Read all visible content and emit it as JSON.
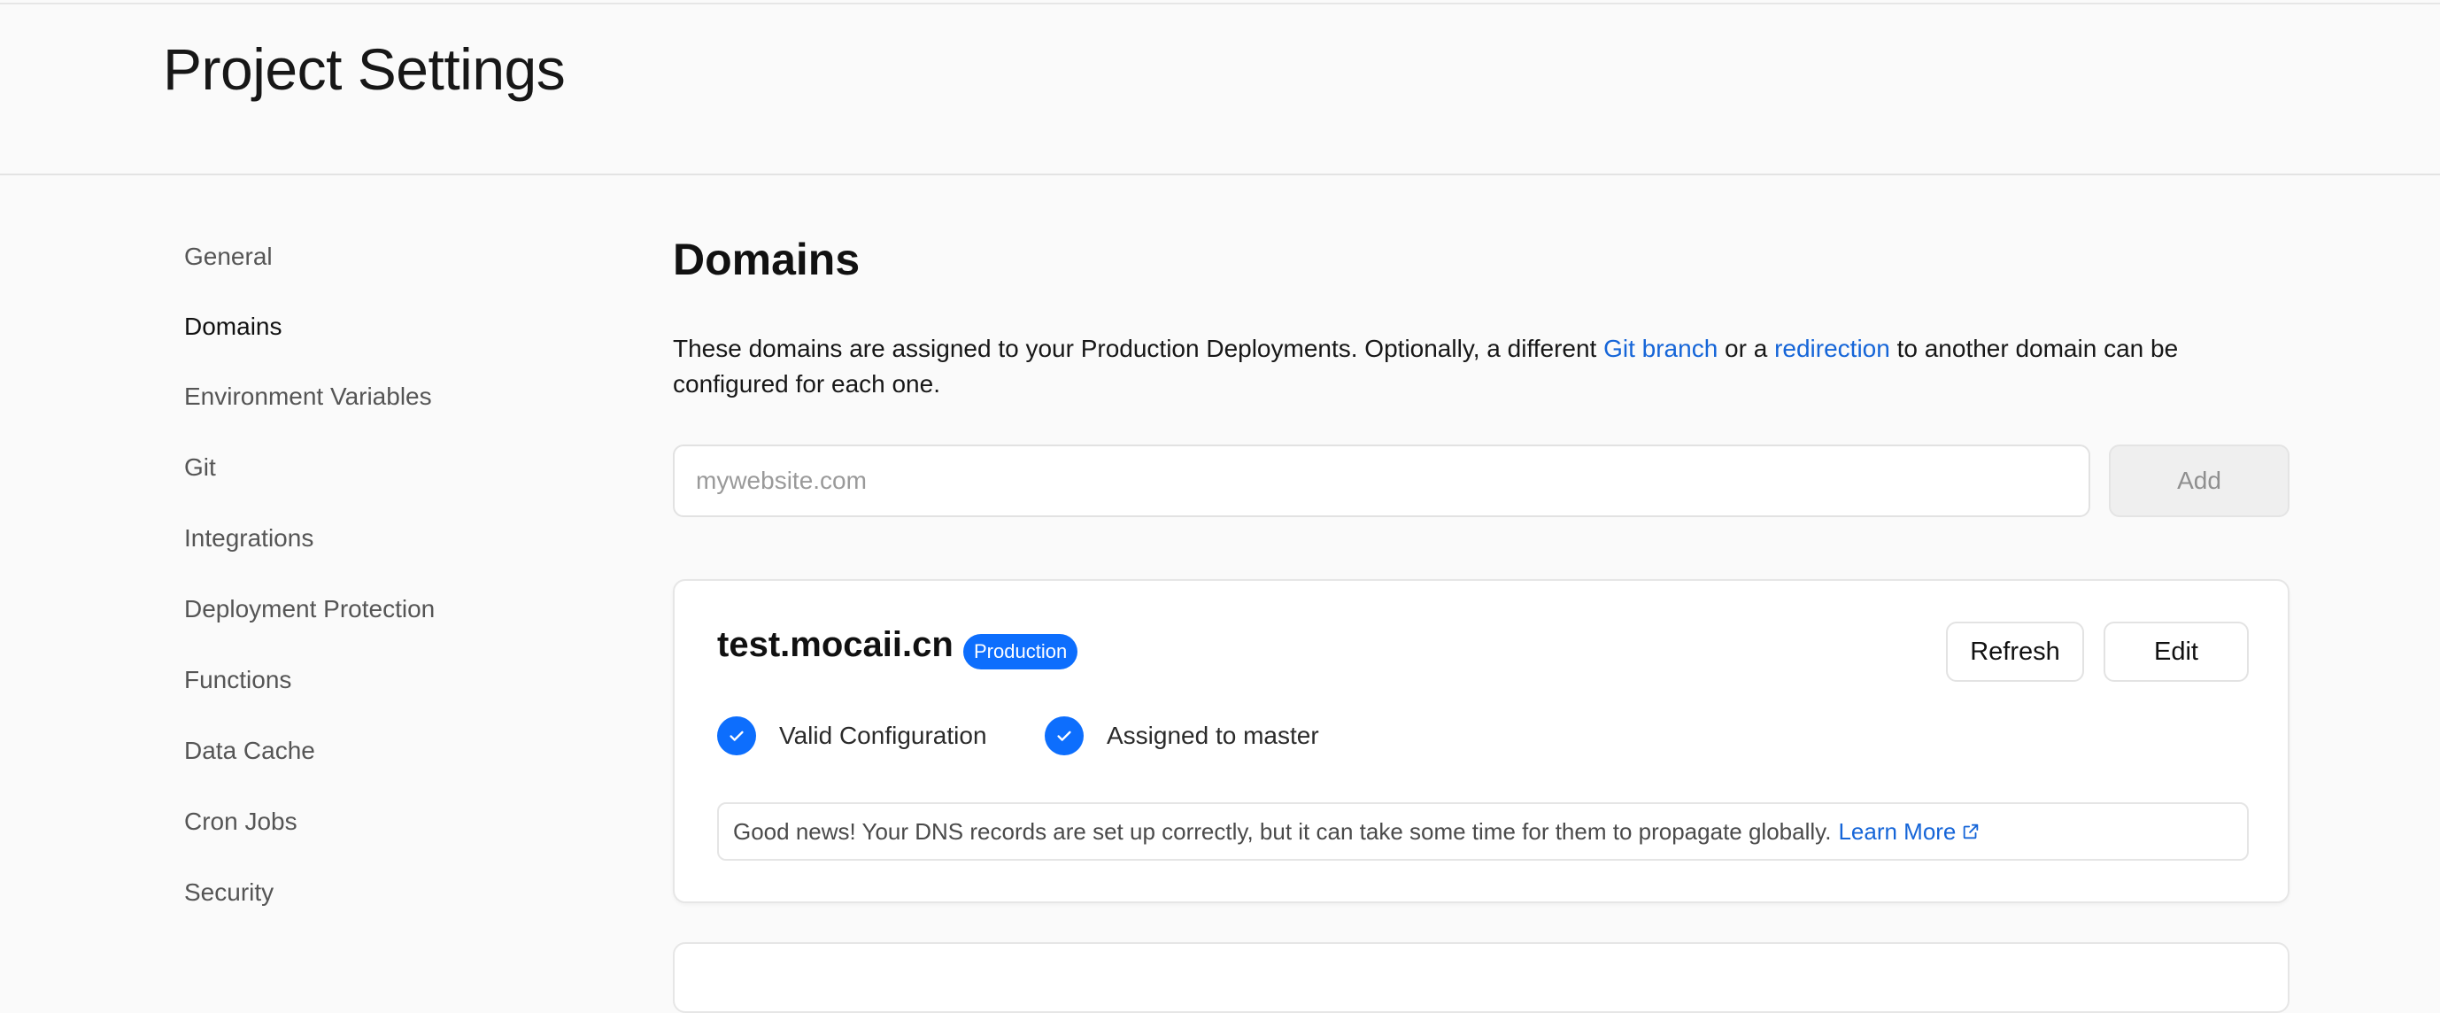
{
  "header": {
    "title": "Project Settings"
  },
  "sidebar": {
    "items": [
      {
        "label": "General",
        "active": false
      },
      {
        "label": "Domains",
        "active": true
      },
      {
        "label": "Environment Variables",
        "active": false
      },
      {
        "label": "Git",
        "active": false
      },
      {
        "label": "Integrations",
        "active": false
      },
      {
        "label": "Deployment Protection",
        "active": false
      },
      {
        "label": "Functions",
        "active": false
      },
      {
        "label": "Data Cache",
        "active": false
      },
      {
        "label": "Cron Jobs",
        "active": false
      },
      {
        "label": "Security",
        "active": false
      }
    ]
  },
  "main": {
    "title": "Domains",
    "description": {
      "part1": "These domains are assigned to your Production Deployments. Optionally, a different ",
      "link1": "Git branch",
      "part2": " or a ",
      "link2": "redirection",
      "part3": " to another domain can be configured for each one."
    },
    "add_domain": {
      "placeholder": "mywebsite.com",
      "value": "",
      "button_label": "Add"
    },
    "domains": [
      {
        "name": "test.mocaii.cn",
        "badge": "Production",
        "refresh_label": "Refresh",
        "edit_label": "Edit",
        "statuses": [
          {
            "label": "Valid Configuration",
            "icon": "check-circle-icon"
          },
          {
            "label": "Assigned to master",
            "icon": "check-circle-icon"
          }
        ],
        "notice": {
          "text": "Good news! Your DNS records are set up correctly, but it can take some time for them to propagate globally.",
          "link": "Learn More",
          "link_icon": "external-link-icon"
        }
      }
    ]
  },
  "colors": {
    "accent": "#0d6efd",
    "link": "#1565d8",
    "background": "#fafafa",
    "border": "#e3e3e3"
  }
}
